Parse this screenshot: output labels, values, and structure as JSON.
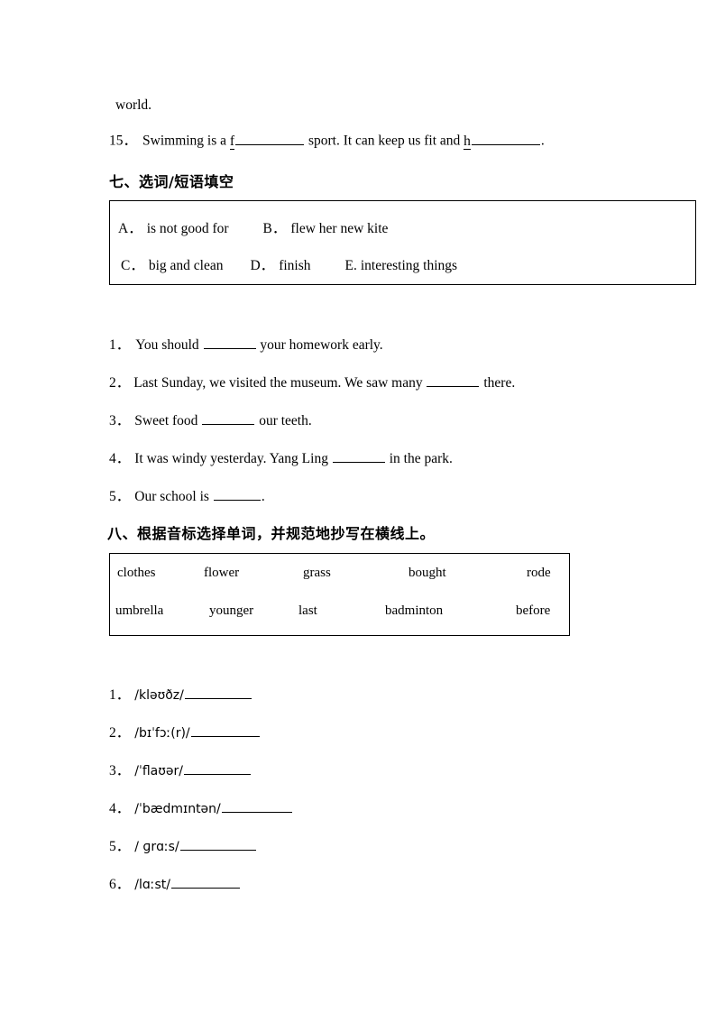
{
  "document": {
    "continued_line": "world.",
    "question_15": {
      "number": "15．",
      "text_part1": "Swimming is a ",
      "hint1": "f",
      "text_part2": " sport. It can keep us fit and ",
      "hint2": "h",
      "text_part3": "."
    }
  },
  "section_seven": {
    "heading": "七、选词/短语填空",
    "choices": [
      {
        "letter": "A．",
        "text": "is not good for"
      },
      {
        "letter": "B．",
        "text": "flew her new kite"
      },
      {
        "letter": "C．",
        "text": "big and clean"
      },
      {
        "letter": "D．",
        "text": "finish"
      },
      {
        "letter": "E.",
        "text": "interesting things"
      }
    ],
    "questions": [
      {
        "number": "1．",
        "before": "You should ",
        "after": " your homework early."
      },
      {
        "number": "2．",
        "before": "Last Sunday, we visited the museum. We saw many ",
        "after": " there."
      },
      {
        "number": "3．",
        "before": "Sweet food ",
        "after": " our teeth."
      },
      {
        "number": "4．",
        "before": "It was windy yesterday. Yang Ling ",
        "after": " in the park."
      },
      {
        "number": "5．",
        "before": "Our school is ",
        "after": "."
      }
    ]
  },
  "section_eight": {
    "heading": "八、根据音标选择单词，并规范地抄写在横线上。",
    "word_bank": {
      "row1": [
        "clothes",
        "flower",
        "grass",
        "bought",
        "rode"
      ],
      "row2": [
        "umbrella",
        "younger",
        "last",
        "badminton",
        "before"
      ]
    },
    "phonetic_items": [
      {
        "number": "1．",
        "ipa": "/kləʊðz/"
      },
      {
        "number": "2．",
        "ipa": "/bɪˈfɔː(r)/"
      },
      {
        "number": "3．",
        "ipa": "/ˈflaʊər/"
      },
      {
        "number": "4．",
        "ipa": "/ˈbædmɪntən/"
      },
      {
        "number": "5．",
        "ipa": "/ ɡrɑːs/"
      },
      {
        "number": "6．",
        "ipa": "/lɑːst/"
      }
    ]
  }
}
